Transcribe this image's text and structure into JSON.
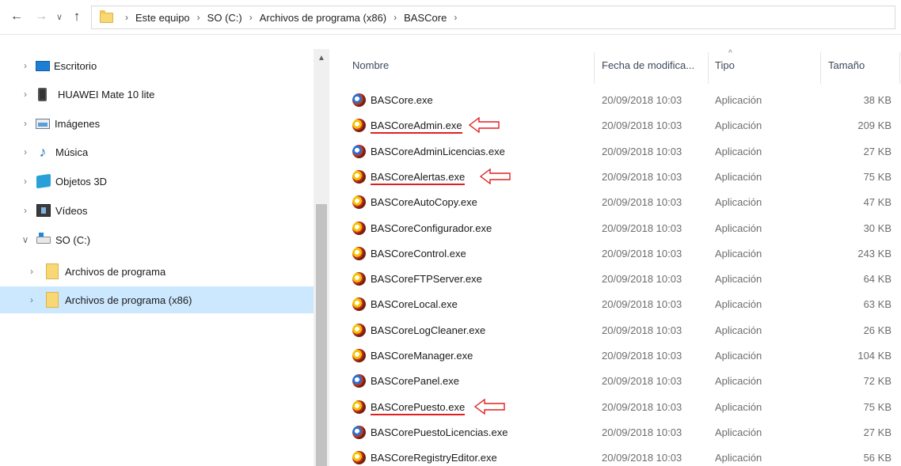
{
  "address_bar": {
    "breadcrumbs": [
      "Este equipo",
      "SO (C:)",
      "Archivos de programa (x86)",
      "BASCore"
    ]
  },
  "navigation_pane": {
    "items": [
      {
        "label": "Escritorio",
        "icon": "desktop-icon",
        "expanded": false,
        "selected": false
      },
      {
        "label": "HUAWEI Mate 10 lite",
        "icon": "phone-icon",
        "expanded": false,
        "selected": false
      },
      {
        "label": "Imágenes",
        "icon": "images-icon",
        "expanded": false,
        "selected": false
      },
      {
        "label": "Música",
        "icon": "music-icon",
        "expanded": false,
        "selected": false
      },
      {
        "label": "Objetos 3D",
        "icon": "objects-3d-icon",
        "expanded": false,
        "selected": false
      },
      {
        "label": "Vídeos",
        "icon": "videos-icon",
        "expanded": false,
        "selected": false
      },
      {
        "label": "SO (C:)",
        "icon": "drive-icon",
        "expanded": true,
        "selected": false
      },
      {
        "label": "Archivos de programa",
        "icon": "folder-icon",
        "expanded": false,
        "selected": false
      },
      {
        "label": "Archivos de programa (x86)",
        "icon": "folder-icon",
        "expanded": false,
        "selected": true
      }
    ]
  },
  "file_list": {
    "columns": {
      "name": "Nombre",
      "date": "Fecha de modifica...",
      "type": "Tipo",
      "size": "Tamaño"
    },
    "files": [
      {
        "name": "BASCore.exe",
        "date": "20/09/2018 10:03",
        "type": "Aplicación",
        "size": "38 KB",
        "marked": false
      },
      {
        "name": "BASCoreAdmin.exe",
        "date": "20/09/2018 10:03",
        "type": "Aplicación",
        "size": "209 KB",
        "marked": true
      },
      {
        "name": "BASCoreAdminLicencias.exe",
        "date": "20/09/2018 10:03",
        "type": "Aplicación",
        "size": "27 KB",
        "marked": false
      },
      {
        "name": "BASCoreAlertas.exe",
        "date": "20/09/2018 10:03",
        "type": "Aplicación",
        "size": "75 KB",
        "marked": true
      },
      {
        "name": "BASCoreAutoCopy.exe",
        "date": "20/09/2018 10:03",
        "type": "Aplicación",
        "size": "47 KB",
        "marked": false
      },
      {
        "name": "BASCoreConfigurador.exe",
        "date": "20/09/2018 10:03",
        "type": "Aplicación",
        "size": "30 KB",
        "marked": false
      },
      {
        "name": "BASCoreControl.exe",
        "date": "20/09/2018 10:03",
        "type": "Aplicación",
        "size": "243 KB",
        "marked": false
      },
      {
        "name": "BASCoreFTPServer.exe",
        "date": "20/09/2018 10:03",
        "type": "Aplicación",
        "size": "64 KB",
        "marked": false
      },
      {
        "name": "BASCoreLocal.exe",
        "date": "20/09/2018 10:03",
        "type": "Aplicación",
        "size": "63 KB",
        "marked": false
      },
      {
        "name": "BASCoreLogCleaner.exe",
        "date": "20/09/2018 10:03",
        "type": "Aplicación",
        "size": "26 KB",
        "marked": false
      },
      {
        "name": "BASCoreManager.exe",
        "date": "20/09/2018 10:03",
        "type": "Aplicación",
        "size": "104 KB",
        "marked": false
      },
      {
        "name": "BASCorePanel.exe",
        "date": "20/09/2018 10:03",
        "type": "Aplicación",
        "size": "72 KB",
        "marked": false
      },
      {
        "name": "BASCorePuesto.exe",
        "date": "20/09/2018 10:03",
        "type": "Aplicación",
        "size": "75 KB",
        "marked": true
      },
      {
        "name": "BASCorePuestoLicencias.exe",
        "date": "20/09/2018 10:03",
        "type": "Aplicación",
        "size": "27 KB",
        "marked": false
      },
      {
        "name": "BASCoreRegistryEditor.exe",
        "date": "20/09/2018 10:03",
        "type": "Aplicación",
        "size": "56 KB",
        "marked": false
      }
    ]
  },
  "colors": {
    "selection": "#cce8ff",
    "annotation": "#e02020",
    "scroll_thumb": "#c2c2c2"
  }
}
